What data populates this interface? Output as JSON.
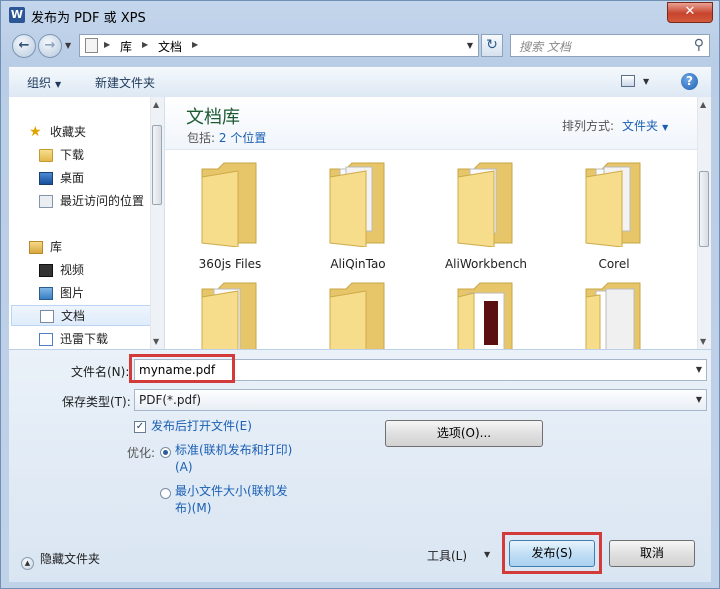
{
  "window": {
    "app_icon": "W",
    "title": "发布为 PDF 或 XPS",
    "close": "✕"
  },
  "address": {
    "segments": [
      "库",
      "文档"
    ],
    "search_placeholder": "搜索 文档"
  },
  "toolbar": {
    "organize": "组织",
    "new_folder": "新建文件夹",
    "help": "?"
  },
  "nav": {
    "favorites": "收藏夹",
    "downloads": "下载",
    "desktop": "桌面",
    "recent": "最近访问的位置",
    "libraries": "库",
    "videos": "视频",
    "pictures": "图片",
    "documents": "文档",
    "thunder": "迅雷下载"
  },
  "library": {
    "title": "文档库",
    "includes_label": "包括:",
    "includes_link": "2 个位置",
    "arrange_label": "排列方式:",
    "arrange_value": "文件夹"
  },
  "folders": [
    {
      "label": "360js Files"
    },
    {
      "label": "AliQinTao"
    },
    {
      "label": "AliWorkbench"
    },
    {
      "label": "Corel"
    },
    {
      "label": ""
    },
    {
      "label": ""
    },
    {
      "label": ""
    },
    {
      "label": ""
    }
  ],
  "form": {
    "filename_label": "文件名(N):",
    "filename_value": "myname.pdf",
    "type_label": "保存类型(T):",
    "type_value": "PDF(*.pdf)",
    "open_after_label": "发布后打开文件(E)",
    "open_after_checked": true,
    "optimize_label": "优化:",
    "opt_standard_line1": "标准(联机发布和打印)",
    "opt_standard_line2": "(A)",
    "opt_min_line1": "最小文件大小(联机发",
    "opt_min_line2": "布)(M)",
    "selected_optimize": "standard",
    "options_button": "选项(O)..."
  },
  "footer": {
    "hide_folders": "隐藏文件夹",
    "tools": "工具(L)",
    "publish": "发布(S)",
    "cancel": "取消"
  },
  "colors": {
    "highlight_box": "#d33a3a",
    "link_blue": "#1a5fb4",
    "library_title": "#1e5a32"
  }
}
